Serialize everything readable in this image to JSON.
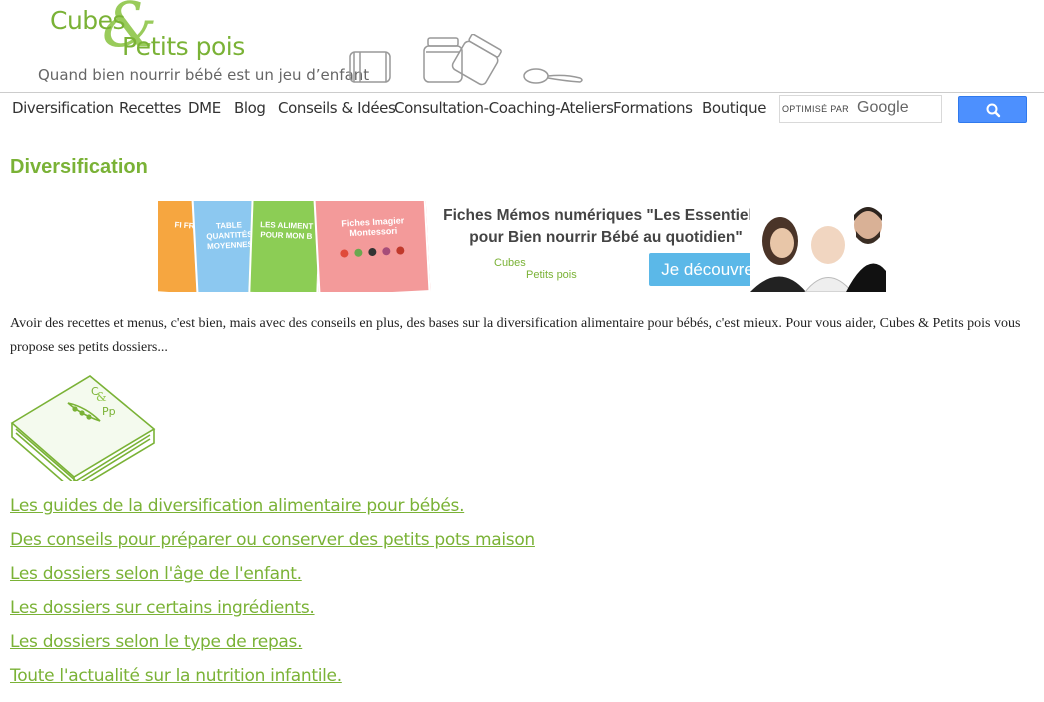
{
  "header": {
    "logo_line1": "Cubes",
    "logo_amp": "&",
    "logo_line2": "Petits pois",
    "tagline": "Quand bien nourrir bébé est un jeu d’enfant"
  },
  "nav": {
    "items": [
      "Diversification",
      "Recettes",
      "DME",
      "Blog",
      "Conseils & Idées",
      "Consultation-Coaching-Ateliers",
      "Formations",
      "Boutique"
    ],
    "search_hint": "OPTIMISÉ PAR",
    "search_brand": "Google",
    "search_icon": "search-icon"
  },
  "page": {
    "title": "Diversification"
  },
  "banner": {
    "cards": [
      {
        "text": "FI FRU",
        "color": "#f6a640"
      },
      {
        "text": "TABLE QUANTITÉS MOYENNES",
        "color": "#8cc8f0"
      },
      {
        "text": "LES ALIMENT POUR MON B",
        "color": "#8ccd55"
      },
      {
        "text": "Fiches Imagier Montessori",
        "color": "#f39a9a"
      }
    ],
    "headline_1": "Fiches Mémos numériques \"Les Essentiels\"",
    "headline_2": "pour Bien nourrir Bébé au quotidien\"",
    "logo_1": "Cubes",
    "logo_2": "Petits pois",
    "button_label": "Je découvre"
  },
  "intro": {
    "text": "Avoir des recettes et menus, c'est bien, mais avec des conseils en plus, des bases sur la diversification alimentaire pour bébés, c'est mieux. Pour vous aider, Cubes & Petits pois vous propose ses petits dossiers..."
  },
  "book": {
    "label_top": "C",
    "label_amp": "&",
    "label_bottom": "Pp"
  },
  "links": [
    "Les guides de la diversification alimentaire pour bébés.",
    "Des conseils pour préparer ou conserver des petits pots maison",
    "Les dossiers selon l'âge de l'enfant.",
    "Les dossiers sur certains ingrédients.",
    "Les dossiers selon le type de repas.",
    "Toute l'actualité sur la nutrition infantile."
  ],
  "colors": {
    "brand_green": "#7ab236",
    "search_blue": "#4d90fe",
    "banner_button": "#5bb8e8"
  }
}
